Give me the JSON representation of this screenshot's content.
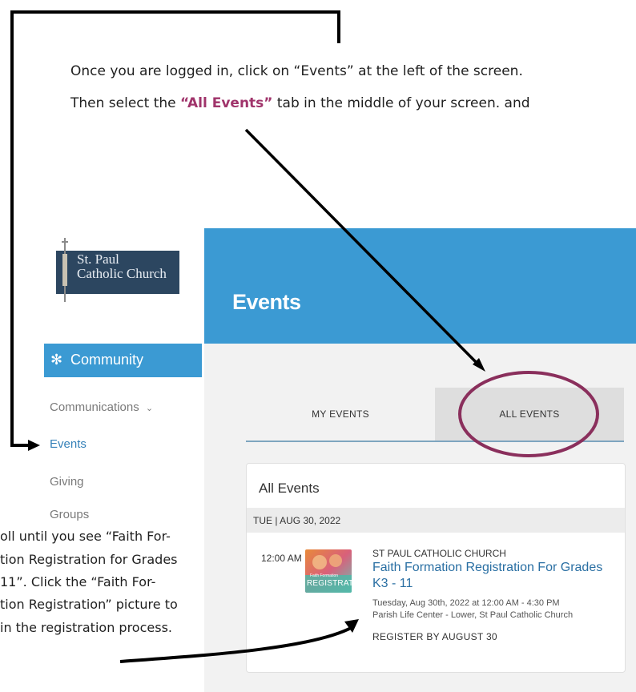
{
  "instructions": {
    "line1": "Once you are logged in, click on “Events” at the left of the screen.",
    "line2_before": "Then select the ",
    "line2_highlight": "“All Events”",
    "line2_after": " tab in the middle of your screen.  and",
    "bottom_lines": [
      "oll until you see “Faith For-",
      "tion Registration for Grades",
      "11”. Click the “Faith For-",
      "tion Registration” picture to",
      "in the registration process."
    ]
  },
  "logo": {
    "text": "St. Paul\nCatholic Church"
  },
  "banner": {
    "title": "Events"
  },
  "sidebar": {
    "section": "Community",
    "section_icon": "community-icon",
    "items": [
      {
        "label": "Communications",
        "has_chevron": true
      },
      {
        "label": "Events"
      },
      {
        "label": "Giving"
      },
      {
        "label": "Groups"
      }
    ]
  },
  "tabs": [
    {
      "label": "MY EVENTS"
    },
    {
      "label": "ALL EVENTS",
      "active": true
    }
  ],
  "card": {
    "title": "All Events",
    "date_header": "TUE | AUG 30, 2022",
    "event": {
      "time": "12:00 AM",
      "thumbnail_text": {
        "top": "Faith Formation",
        "bottom": "REGISTRATION"
      },
      "organization": "ST PAUL CATHOLIC CHURCH",
      "name": "Faith Formation Registration For Grades K3 - 11",
      "datetime": "Tuesday, Aug 30th, 2022 at 12:00 AM - 4:30 PM",
      "location": "Parish Life Center - Lower, St Paul Catholic Church",
      "register_by": "REGISTER BY AUGUST 30"
    }
  },
  "colors": {
    "accent_blue": "#3b9ad3",
    "highlight_purple": "#a0346b",
    "circle": "#8a2f5c",
    "link_blue": "#2a6fa3"
  }
}
